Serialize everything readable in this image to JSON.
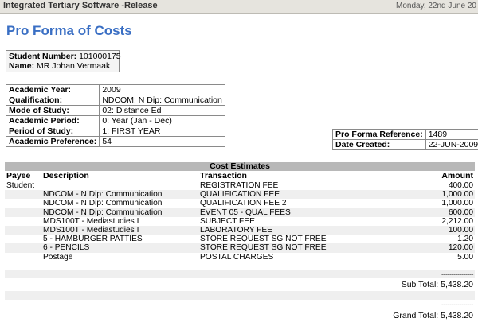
{
  "app": {
    "title": "Integrated Tertiary Software -Release",
    "date": "Monday, 22nd June 20"
  },
  "page_title": "Pro Forma of Costs",
  "student": {
    "number_label": "Student Number:",
    "number": "101000175",
    "name_label": "Name:",
    "name": "MR Johan Vermaak"
  },
  "details": [
    {
      "label": "Academic Year:",
      "value": "2009"
    },
    {
      "label": "Qualification:",
      "value": "NDCOM: N Dip: Communication"
    },
    {
      "label": "Mode of Study:",
      "value": "02: Distance Ed"
    },
    {
      "label": "Academic Period:",
      "value": "0: Year (Jan - Dec)"
    },
    {
      "label": "Period of Study:",
      "value": "1: FIRST YEAR"
    },
    {
      "label": "Academic Preference:",
      "value": "54"
    }
  ],
  "reference": [
    {
      "label": "Pro Forma Reference:",
      "value": "1489"
    },
    {
      "label": "Date Created:",
      "value": "22-JUN-2009"
    }
  ],
  "costs": {
    "title": "Cost Estimates",
    "columns": {
      "payee": "Payee",
      "description": "Description",
      "transaction": "Transaction",
      "amount": "Amount"
    },
    "rows": [
      {
        "payee": "Student",
        "description": "",
        "transaction": "REGISTRATION FEE",
        "amount": "400.00"
      },
      {
        "payee": "",
        "description": "NDCOM - N Dip: Communication",
        "transaction": "QUALIFICATION FEE",
        "amount": "1,000.00"
      },
      {
        "payee": "",
        "description": "NDCOM - N Dip: Communication",
        "transaction": "QUALIFICATION FEE 2",
        "amount": "1,000.00"
      },
      {
        "payee": "",
        "description": "NDCOM - N Dip: Communication",
        "transaction": "EVENT 05 - QUAL FEES",
        "amount": "600.00"
      },
      {
        "payee": "",
        "description": "MDS100T - Mediastudies I",
        "transaction": "SUBJECT FEE",
        "amount": "2,212.00"
      },
      {
        "payee": "",
        "description": "MDS100T - Mediastudies I",
        "transaction": "LABORATORY FEE",
        "amount": "100.00"
      },
      {
        "payee": "",
        "description": "5 - HAMBURGER PATTIES",
        "transaction": "STORE REQUEST SG NOT FREE",
        "amount": "1.20"
      },
      {
        "payee": "",
        "description": "6 - PENCILS",
        "transaction": "STORE REQUEST SG NOT FREE",
        "amount": "120.00"
      },
      {
        "payee": "",
        "description": "Postage",
        "transaction": "POSTAL CHARGES",
        "amount": "5.00"
      }
    ],
    "dashes": "----------------",
    "sub_total_label": "Sub Total:",
    "sub_total": "5,438.20",
    "grand_total_label": "Grand Total:",
    "grand_total": "5,438.20"
  }
}
